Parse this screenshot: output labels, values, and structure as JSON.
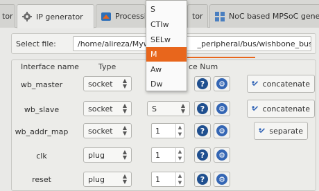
{
  "tabs": [
    {
      "label": "tor"
    },
    {
      "label": "IP generator"
    },
    {
      "label": "Processin"
    },
    {
      "label": "tor"
    },
    {
      "label": "NoC based MPSoC generato"
    }
  ],
  "file": {
    "label": "Select file:",
    "path_prefix": "/home/alireza/Mywo",
    "path_suffix": "_peripheral/bus/wishbone_bus.v"
  },
  "headers": {
    "name": "Interface name",
    "type": "Type",
    "num": "ce Num"
  },
  "rows": [
    {
      "name": "wb_master",
      "type": "socket",
      "num": "",
      "action": "concatenate"
    },
    {
      "name": "wb_slave",
      "type": "socket",
      "num": "S",
      "action": "concatenate"
    },
    {
      "name": "wb_addr_map",
      "type": "socket",
      "num": "1",
      "action": "separate"
    },
    {
      "name": "clk",
      "type": "plug",
      "num": "1",
      "action": ""
    },
    {
      "name": "reset",
      "type": "plug",
      "num": "1",
      "action": ""
    }
  ],
  "dropdown": {
    "options": [
      "S",
      "CTIw",
      "SELw",
      "M",
      "Aw",
      "Dw"
    ],
    "selected": "M"
  },
  "colors": {
    "accent": "#e8661c",
    "help": "#1f4f8f",
    "settings": "#3466b4",
    "action_icon": "#2f62b5"
  }
}
